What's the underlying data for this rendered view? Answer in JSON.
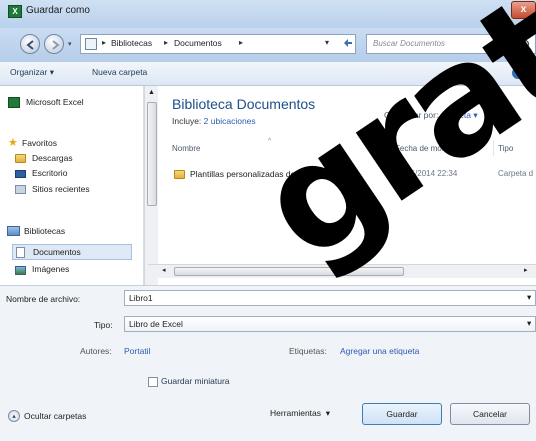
{
  "window": {
    "title": "Guardar como",
    "close_label": "x"
  },
  "nav": {
    "breadcrumbs": [
      "Bibliotecas",
      "Documentos"
    ],
    "search_placeholder": "Buscar Documentos"
  },
  "toolbar": {
    "organize": "Organizar",
    "new_folder": "Nueva carpeta"
  },
  "sidebar": {
    "top_item": "Microsoft Excel",
    "favorites": "Favoritos",
    "fav_items": [
      "Descargas",
      "Escritorio",
      "Sitios recientes"
    ],
    "libraries": "Bibliotecas",
    "lib_items": [
      "Documentos",
      "Imágenes"
    ]
  },
  "library": {
    "title": "Biblioteca Documentos",
    "includes_label": "Incluye:",
    "includes_link": "2 ubicaciones",
    "arrange_label": "Organizar por:",
    "arrange_value": "Carpeta"
  },
  "columns": [
    "Nombre",
    "Fecha de modifica...",
    "Tipo"
  ],
  "files": [
    {
      "name": "Plantillas personalizadas de Office",
      "date": "27/05/2014 22:34",
      "type": "Carpeta d"
    }
  ],
  "form": {
    "filename_label": "Nombre de archivo:",
    "filename_value": "Libro1",
    "type_label": "Tipo:",
    "type_value": "Libro de Excel",
    "authors_label": "Autores:",
    "authors_value": "Portatil",
    "tags_label": "Etiquetas:",
    "tags_value": "Agregar una etiqueta",
    "thumbnail_label": "Guardar miniatura"
  },
  "footer": {
    "hide_folders": "Ocultar carpetas",
    "tools": "Herramientas",
    "save": "Guardar",
    "cancel": "Cancelar"
  },
  "watermark": "grat",
  "colors": {
    "titlebar": "#c4d8ef",
    "link": "#2a5db0",
    "close": "#c44a32"
  }
}
